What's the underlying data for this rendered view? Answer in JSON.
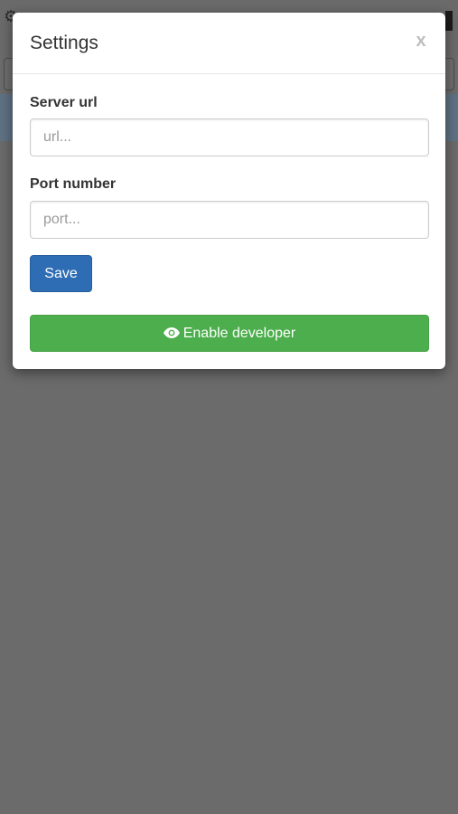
{
  "modal": {
    "title": "Settings",
    "close_label": "x"
  },
  "form": {
    "server_url": {
      "label": "Server url",
      "placeholder": "url...",
      "value": ""
    },
    "port_number": {
      "label": "Port number",
      "placeholder": "port...",
      "value": ""
    },
    "save_label": "Save"
  },
  "developer": {
    "label": "Enable developer",
    "icon": "eye-icon"
  },
  "colors": {
    "primary": "#2e6db4",
    "success": "#4cae4c",
    "overlay": "#6b6b6b"
  }
}
